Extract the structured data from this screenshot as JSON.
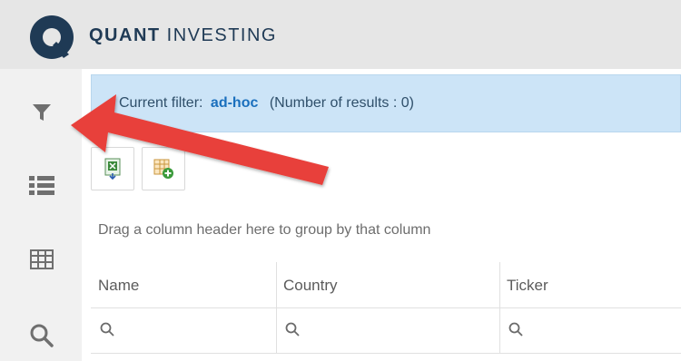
{
  "brand": {
    "strong": "QUANT",
    "light": "INVESTING"
  },
  "filter": {
    "label": "Current filter:",
    "value": "ad-hoc",
    "results": "(Number of results : 0)"
  },
  "toolbar": {
    "buttons": [
      "export-excel",
      "add-columns"
    ]
  },
  "group_hint": "Drag a column header here to group by that column",
  "columns": [
    "Name",
    "Country",
    "Ticker"
  ],
  "sidebar": {
    "icons": [
      "filter-icon",
      "list-icon",
      "table-icon",
      "search-icon"
    ]
  },
  "colors": {
    "accent": "#1a6fbd",
    "filter_bg": "#cce4f7",
    "arrow": "#e8403a",
    "brand": "#1f3a55"
  }
}
